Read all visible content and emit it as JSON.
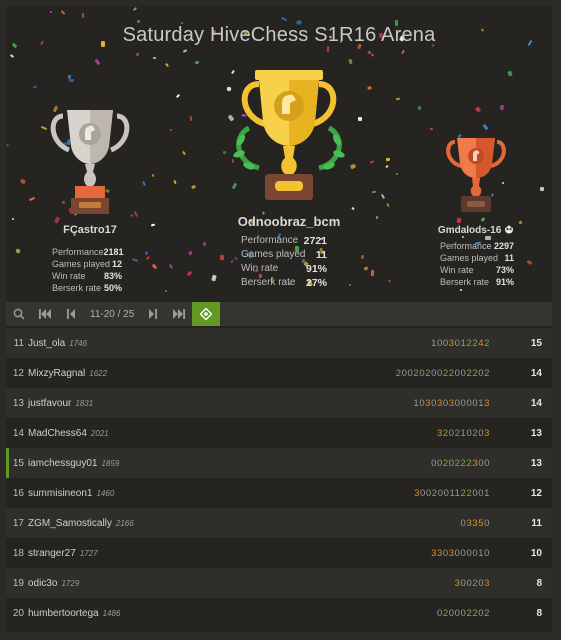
{
  "title": "Saturday HiveChess S1R16 Arena",
  "podium": {
    "first": {
      "name": "Odnoobraz_bcm",
      "stats": [
        {
          "label": "Performance",
          "value": "2721"
        },
        {
          "label": "Games played",
          "value": "11"
        },
        {
          "label": "Win rate",
          "value": "91%"
        },
        {
          "label": "Berserk rate",
          "value": "27%"
        }
      ]
    },
    "second": {
      "name": "FCastro17",
      "stats": [
        {
          "label": "Performance",
          "value": "2181"
        },
        {
          "label": "Games played",
          "value": "12"
        },
        {
          "label": "Win rate",
          "value": "83%"
        },
        {
          "label": "Berserk rate",
          "value": "50%"
        }
      ]
    },
    "third": {
      "name": "Gmdalods-16",
      "stats": [
        {
          "label": "Performance",
          "value": "2297"
        },
        {
          "label": "Games played",
          "value": "11"
        },
        {
          "label": "Win rate",
          "value": "73%"
        },
        {
          "label": "Berserk rate",
          "value": "91%"
        }
      ]
    }
  },
  "toolbar": {
    "page_label": "11-20 / 25",
    "icons": [
      "search-icon",
      "first-page-icon",
      "prev-page-icon",
      "next-page-icon",
      "last-page-icon",
      "jump-to-me-icon"
    ]
  },
  "standings": [
    {
      "rank": "11",
      "name": "Just_ola",
      "rating": "1746",
      "sheet": "1003012242",
      "total": "15"
    },
    {
      "rank": "12",
      "name": "MixzyRagnal",
      "rating": "1622",
      "sheet": "2002020022002202",
      "total": "14"
    },
    {
      "rank": "13",
      "name": "justfavour",
      "rating": "1831",
      "sheet": "1030303000013",
      "total": "14"
    },
    {
      "rank": "14",
      "name": "MadChess64",
      "rating": "2021",
      "sheet": "320210203",
      "total": "13"
    },
    {
      "rank": "15",
      "name": "iamchessguy01",
      "rating": "1859",
      "sheet": "0020222300",
      "total": "13"
    },
    {
      "rank": "16",
      "name": "summisineon1",
      "rating": "1460",
      "sheet": "3002001122001",
      "total": "12"
    },
    {
      "rank": "17",
      "name": "ZGM_Samostically",
      "rating": "2166",
      "sheet": "03350",
      "total": "11"
    },
    {
      "rank": "18",
      "name": "stranger27",
      "rating": "1727",
      "sheet": "3303000010",
      "total": "10"
    },
    {
      "rank": "19",
      "name": "odic3o",
      "rating": "1729",
      "sheet": "300203",
      "total": "8"
    },
    {
      "rank": "20",
      "name": "humbertoortega",
      "rating": "1486",
      "sheet": "020002202",
      "total": "8"
    }
  ],
  "colors": {
    "accent": "#629924",
    "gold": "#f2c230",
    "silver": "#c9c4bd",
    "bronze": "#e4683a",
    "win": "#7fa650",
    "fire": "#d59120"
  }
}
